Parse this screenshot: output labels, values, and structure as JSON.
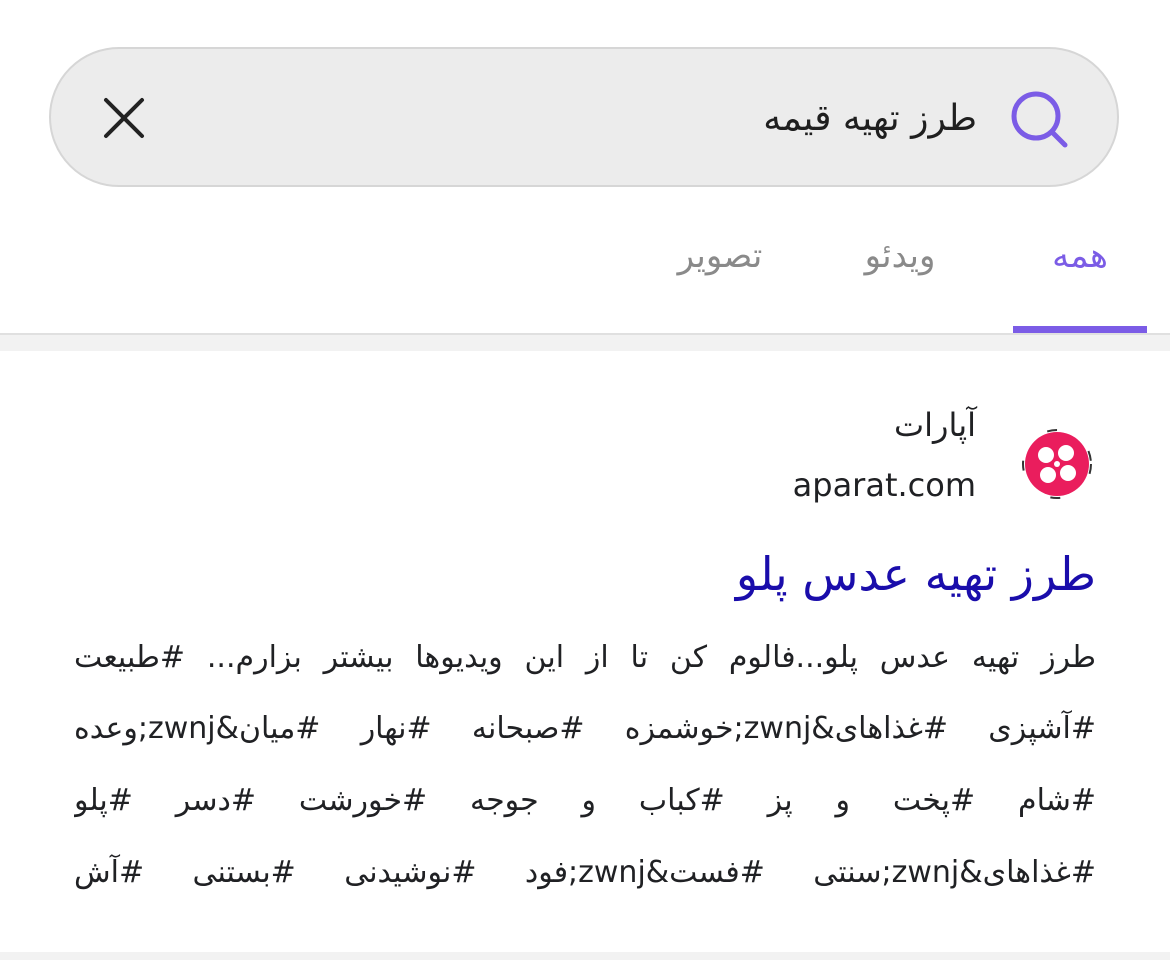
{
  "search": {
    "query": "طرز تهیه قیمه",
    "clear_icon": "close-icon",
    "search_icon": "search-icon",
    "accent_color": "#7b5ce6"
  },
  "tabs": [
    {
      "label": "همه",
      "active": true
    },
    {
      "label": "ویدئو",
      "active": false
    },
    {
      "label": "تصویر",
      "active": false
    }
  ],
  "result": {
    "source_name": "آپارات",
    "source_url": "aparat.com",
    "logo_icon": "aparat-logo",
    "title": "طرز تهیه عدس پلو",
    "snippet_lines": [
      "طرز تهیه عدس پلو...فالوم کن تا از این ویدیوها بیشتر بزارم... #طبیعت",
      "#آشپزی #غذاهای&zwnj;خوشمزه #صبحانه #نهار #میان&zwnj;وعده",
      "#شام #پخت و پز #کباب و جوجه #خورشت #دسر #پلو",
      "#غذاهای&zwnj;سنتی #فست&zwnj;فود #نوشیدنی #بستنی #آش"
    ]
  }
}
